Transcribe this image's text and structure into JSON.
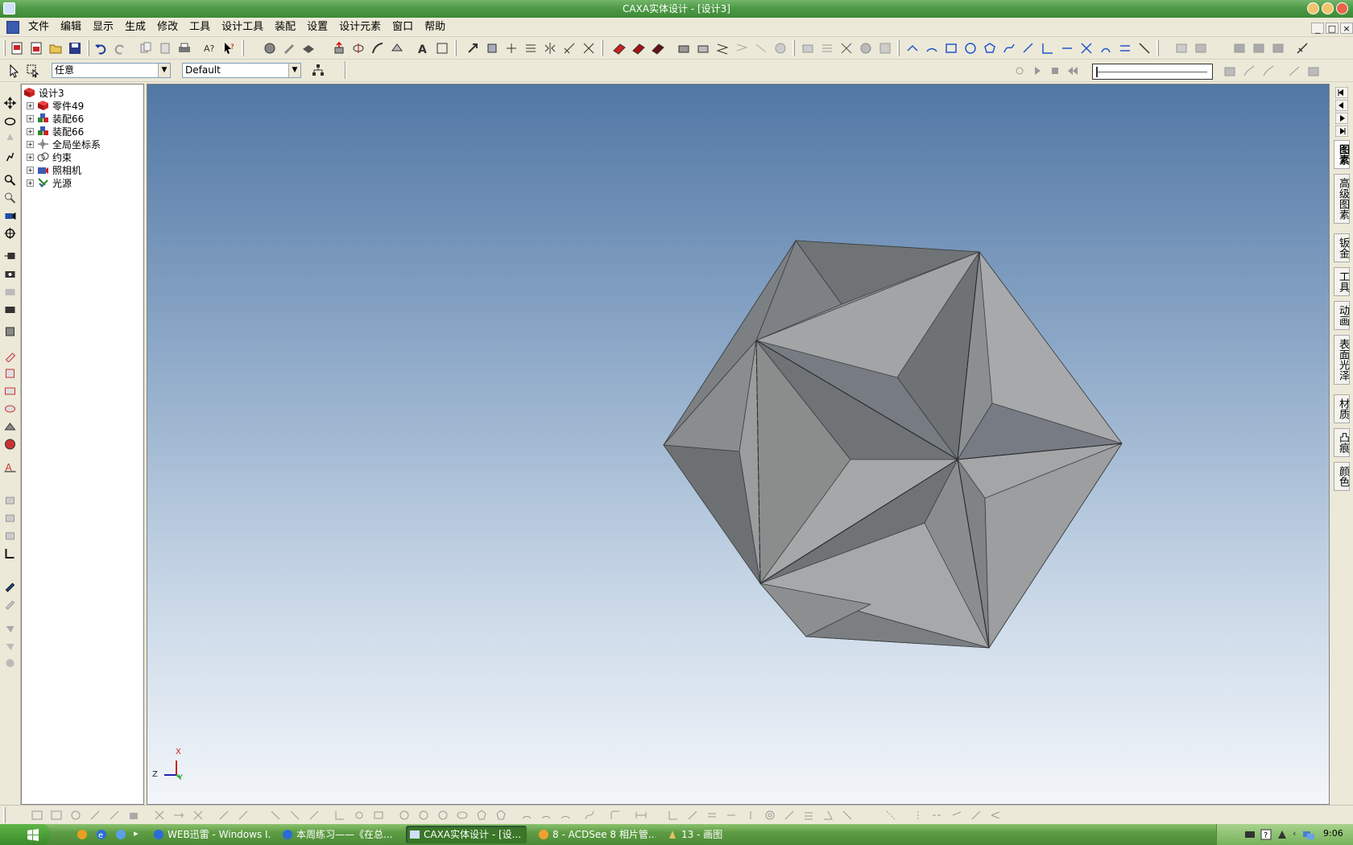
{
  "window": {
    "title": "CAXA实体设计 - [设计3]"
  },
  "menu": [
    "文件",
    "编辑",
    "显示",
    "生成",
    "修改",
    "工具",
    "设计工具",
    "装配",
    "设置",
    "设计元素",
    "窗口",
    "帮助"
  ],
  "selection": {
    "filter_value": "任意",
    "style_value": "Default"
  },
  "tree": {
    "root": "设计3",
    "children": [
      {
        "label": "零件49",
        "icon": "part-icon"
      },
      {
        "label": "装配66",
        "icon": "assembly-icon"
      },
      {
        "label": "装配66",
        "icon": "assembly-icon"
      },
      {
        "label": "全局坐标系",
        "icon": "coordinate-system-icon"
      },
      {
        "label": "约束",
        "icon": "constraint-icon"
      },
      {
        "label": "照相机",
        "icon": "camera-icon"
      },
      {
        "label": "光源",
        "icon": "light-icon"
      }
    ]
  },
  "right_tabs": [
    "图素",
    "高级图素",
    "钣金",
    "工具",
    "动画",
    "表面光泽",
    "材质",
    "凸痕",
    "颜色"
  ],
  "axis": {
    "x": "X",
    "y": "Y",
    "z": "Z"
  },
  "taskbar": {
    "tasks": [
      {
        "label": "WEB迅雷 - Windows I..."
      },
      {
        "label": "本周练习——《在总..."
      },
      {
        "label": "CAXA实体设计 - [设..."
      },
      {
        "label": "8 - ACDSee 8 相片管..."
      },
      {
        "label": "13 - 画图"
      }
    ],
    "clock": "9:06"
  },
  "colors": {
    "model_face": "#9a9c9e",
    "viewport_top": "#5177a4",
    "viewport_bottom": "#f3f6fa"
  }
}
